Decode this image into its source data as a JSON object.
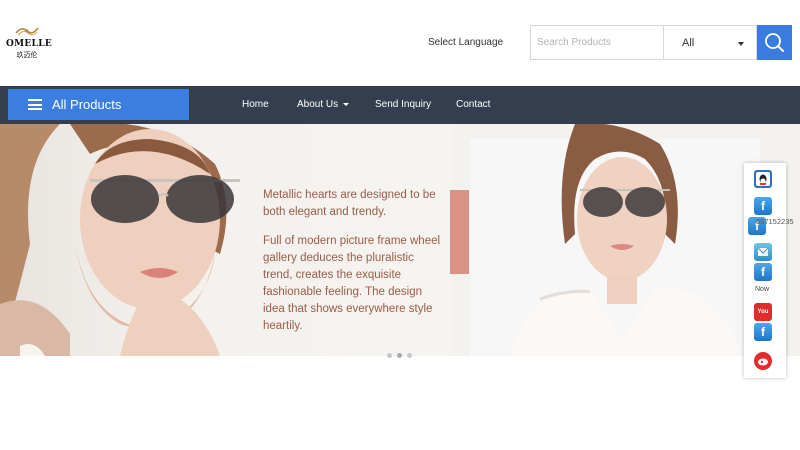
{
  "brand": {
    "name": "OMELLE",
    "name_cn": "玖迈伦"
  },
  "header": {
    "language_label": "Select Language",
    "search_placeholder": "Search Products",
    "category_value": "All"
  },
  "nav": {
    "all_products": "All Products",
    "links": [
      "Home",
      "About Us",
      "Send Inquiry",
      "Contact"
    ]
  },
  "banner": {
    "paragraph1": "Metallic hearts are designed to be both elegant and trendy.",
    "paragraph2": "Full of modern picture frame wheel gallery deduces the pluralistic trend, creates the exquisite fashionable feeling. The design idea that shows everywhere style heartily.",
    "slide_count": 3,
    "active_slide": 1
  },
  "social": {
    "phone_partial": "867152235",
    "now_label": "Now"
  },
  "colors": {
    "accent_blue": "#3b7ee0",
    "nav_bg": "#343e4f",
    "banner_text": "#9a5c46",
    "pink_accent": "#d99285"
  }
}
